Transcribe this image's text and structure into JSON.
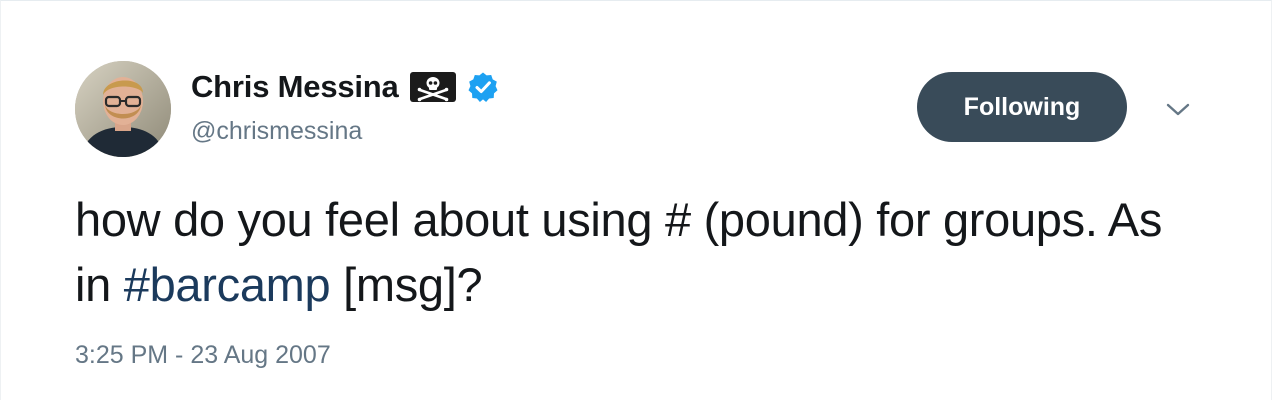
{
  "tweet": {
    "author": {
      "display_name": "Chris Messina",
      "handle": "@chrismessina",
      "name_emoji_icon": "pirate-flag-icon",
      "verified_icon": "verified-badge-icon"
    },
    "follow_button_label": "Following",
    "menu_icon": "chevron-down-icon",
    "text_before": "how do you feel about using # (pound) for groups. As in ",
    "hashtag": "#barcamp",
    "text_after": " [msg]?",
    "timestamp": "3:25 PM - 23 Aug 2007"
  },
  "colors": {
    "button_bg": "#394b59",
    "verified_blue": "#1da1f2",
    "hashtag": "#1b3a5c",
    "secondary_text": "#657786",
    "primary_text": "#14171a"
  }
}
